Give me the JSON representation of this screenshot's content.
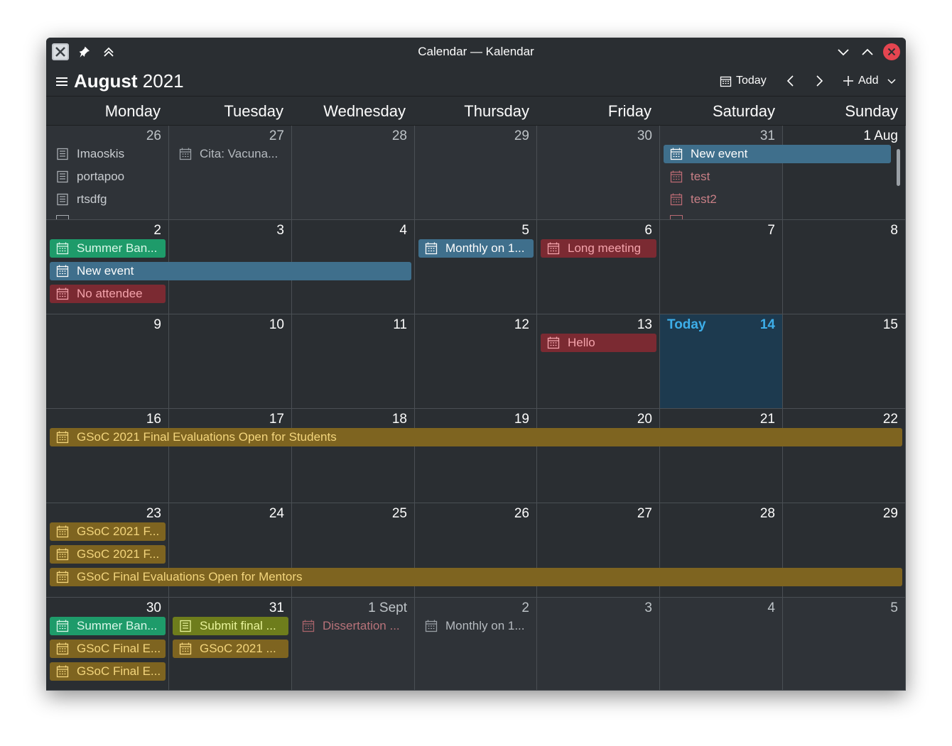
{
  "window": {
    "title": "Calendar — Kalendar"
  },
  "toolbar": {
    "month": "August",
    "year": "2021",
    "today_label": "Today",
    "add_label": "Add"
  },
  "weekdays": [
    "Monday",
    "Tuesday",
    "Wednesday",
    "Thursday",
    "Friday",
    "Saturday",
    "Sunday"
  ],
  "weeks": [
    [
      "26",
      "27",
      "28",
      "29",
      "30",
      "31",
      "1 Aug"
    ],
    [
      "2",
      "3",
      "4",
      "5",
      "6",
      "7",
      "8"
    ],
    [
      "9",
      "10",
      "11",
      "12",
      "13",
      "14",
      "15"
    ],
    [
      "16",
      "17",
      "18",
      "19",
      "20",
      "21",
      "22"
    ],
    [
      "23",
      "24",
      "25",
      "26",
      "27",
      "28",
      "29"
    ],
    [
      "30",
      "31",
      "1 Sept",
      "2",
      "3",
      "4",
      "5"
    ]
  ],
  "today_text": "Today",
  "events": {
    "imaoskis": "Imaoskis",
    "portapoo": "portapoo",
    "rtsdfg": "rtsdfg",
    "cita": "Cita: Vacuna...",
    "new_event_31": "New event",
    "test": "test",
    "test2": "test2",
    "summer_ban_1": "Summer Ban...",
    "new_event_2": "New event",
    "no_attendee": "No attendee",
    "monthly_5": "Monthly on 1...",
    "long_meeting": "Long meeting",
    "hello": "Hello",
    "gsoc_students": "GSoC 2021 Final Evaluations Open for Students",
    "gsoc_f1": "GSoC 2021 F...",
    "gsoc_f2": "GSoC 2021 F...",
    "gsoc_mentors": "GSoC Final Evaluations Open for Mentors",
    "summer_ban_2": "Summer Ban...",
    "gsoc_final_e1": "GSoC Final E...",
    "gsoc_final_e2": "GSoC Final E...",
    "submit_final": "Submit final ...",
    "gsoc_2021_31": "GSoC 2021 ...",
    "dissertation": "Dissertation ...",
    "monthly_2": "Monthly on 1..."
  },
  "colors": {
    "blue": "#3f6f8c",
    "green": "#1e9b6a",
    "red": "#7b2a32",
    "gold": "#7e6420",
    "gold_text": "#f3d57c",
    "lime": "#6e7d1c",
    "today_bg": "#1d3a4f",
    "accent": "#3daee9"
  }
}
